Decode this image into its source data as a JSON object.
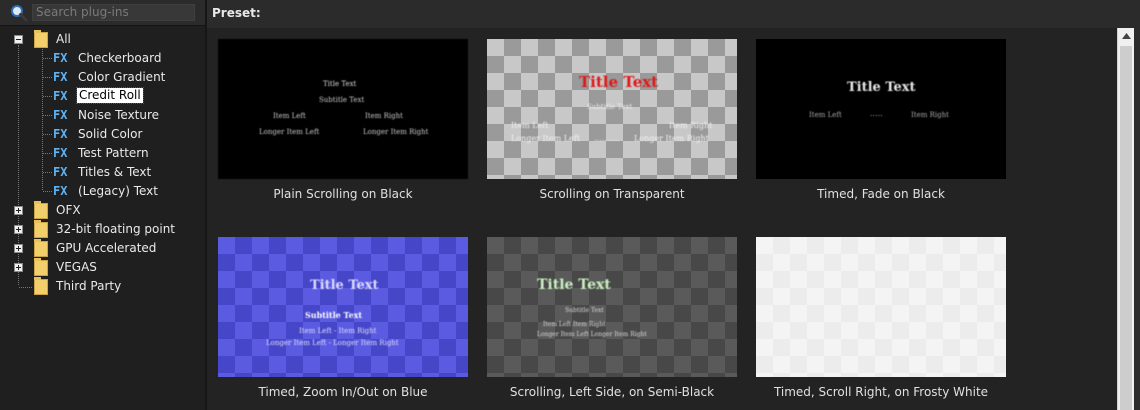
{
  "search": {
    "placeholder": "Search plug-ins"
  },
  "tree": {
    "root_label": "All",
    "fx_badge": "FX",
    "fx_items": [
      {
        "label": "Checkerboard",
        "selected": false
      },
      {
        "label": "Color Gradient",
        "selected": false
      },
      {
        "label": "Credit Roll",
        "selected": true
      },
      {
        "label": "Noise Texture",
        "selected": false
      },
      {
        "label": "Solid Color",
        "selected": false
      },
      {
        "label": "Test Pattern",
        "selected": false
      },
      {
        "label": "Titles & Text",
        "selected": false
      },
      {
        "label": "(Legacy) Text",
        "selected": false
      }
    ],
    "folders": [
      {
        "label": "OFX"
      },
      {
        "label": "32-bit floating point"
      },
      {
        "label": "GPU Accelerated"
      },
      {
        "label": "VEGAS"
      },
      {
        "label": "Third Party"
      }
    ]
  },
  "preset": {
    "label": "Preset:",
    "tiles": [
      {
        "caption": "Plain Scrolling on Black",
        "title": "Title Text",
        "subtitle": "Subtitle Text",
        "item_left": "Item Left",
        "item_right": "Item Right",
        "long_left": "Longer Item Left",
        "long_right": "Longer Item Right"
      },
      {
        "caption": "Scrolling on Transparent",
        "title": "Title Text",
        "subtitle": "Subtitle Text",
        "item_left": "Item Left",
        "item_right": "Item Right",
        "long_left": "Longer Item Left",
        "dots": "..........",
        "long_right": "Longer Item Right",
        "title_color": "#e01818"
      },
      {
        "caption": "Timed, Fade on Black",
        "title": "Title Text",
        "item_left": "Item Left",
        "dots": ".....",
        "item_right": "Item Right"
      },
      {
        "caption": "Timed, Zoom In/Out on Blue",
        "title": "Title Text",
        "subtitle": "Subtitle Text",
        "row1": "Item Left - Item Right",
        "row2": "Longer Item Left - Longer Item Right"
      },
      {
        "caption": "Scrolling, Left Side, on Semi-Black",
        "title": "Title Text",
        "subtitle": "Subtitle Text",
        "row1": "Item Left      Item Right",
        "row2": "Longer Item Left  Longer Item Right",
        "title_color": "#c8f0c0"
      },
      {
        "caption": "Timed, Scroll Right, on Frosty White"
      }
    ]
  }
}
